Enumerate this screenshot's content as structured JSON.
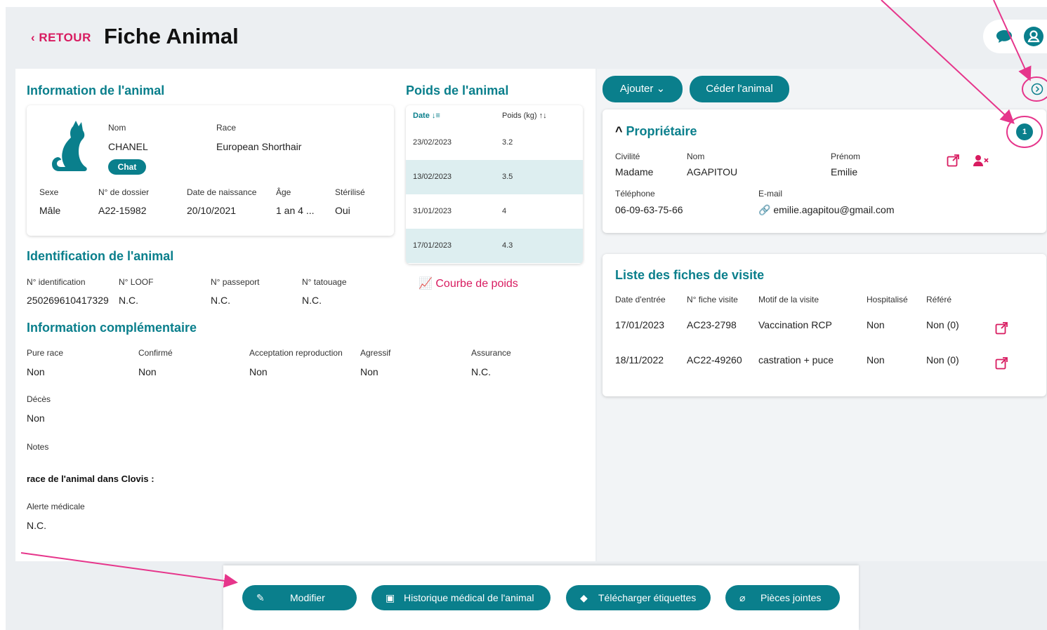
{
  "header": {
    "back_label": "‹ RETOUR",
    "title": "Fiche Animal"
  },
  "animal_info": {
    "heading": "Information de l'animal",
    "nom_label": "Nom",
    "nom": "CHANEL",
    "race_label": "Race",
    "race": "European Shorthair",
    "species_chip": "Chat",
    "sexe_label": "Sexe",
    "sexe": "Mâle",
    "dossier_label": "N° de dossier",
    "dossier": "A22-15982",
    "naissance_label": "Date de naissance",
    "naissance": "20/10/2021",
    "age_label": "Âge",
    "age": "1 an 4 ...",
    "sterilise_label": "Stérilisé",
    "sterilise": "Oui"
  },
  "weights": {
    "heading": "Poids de l'animal",
    "col_date": "Date",
    "col_poids": "Poids (kg)",
    "rows": [
      {
        "date": "23/02/2023",
        "poids": "3.2"
      },
      {
        "date": "13/02/2023",
        "poids": "3.5"
      },
      {
        "date": "31/01/2023",
        "poids": "4"
      },
      {
        "date": "17/01/2023",
        "poids": "4.3"
      }
    ],
    "curve_link": "Courbe de poids"
  },
  "identification": {
    "heading": "Identification de l'animal",
    "fields": [
      {
        "label": "N° identification",
        "value": "250269610417329"
      },
      {
        "label": "N° LOOF",
        "value": "N.C."
      },
      {
        "label": "N° passeport",
        "value": "N.C."
      },
      {
        "label": "N° tatouage",
        "value": "N.C."
      }
    ]
  },
  "complementary": {
    "heading": "Information complémentaire",
    "fields": [
      {
        "label": "Pure race",
        "value": "Non"
      },
      {
        "label": "Confirmé",
        "value": "Non"
      },
      {
        "label": "Acceptation reproduction",
        "value": "Non"
      },
      {
        "label": "Agressif",
        "value": "Non"
      },
      {
        "label": "Assurance",
        "value": "N.C."
      }
    ],
    "deces_label": "Décès",
    "deces": "Non",
    "notes_label": "Notes",
    "race_clovis_label": "race de l'animal dans Clovis :",
    "alerte_label": "Alerte médicale",
    "alerte": "N.C."
  },
  "actions": {
    "ajouter": "Ajouter",
    "ceder": "Céder l'animal"
  },
  "owner": {
    "heading": "Propriétaire",
    "badge": "1",
    "civilite_label": "Civilité",
    "civilite": "Madame",
    "nom_label": "Nom",
    "nom": "AGAPITOU",
    "prenom_label": "Prénom",
    "prenom": "Emilie",
    "tel_label": "Téléphone",
    "tel": "06-09-63-75-66",
    "email_label": "E-mail",
    "email": "emilie.agapitou@gmail.com"
  },
  "visits": {
    "heading": "Liste des fiches de visite",
    "columns": [
      "Date d'entrée",
      "N° fiche visite",
      "Motif de la visite",
      "Hospitalisé",
      "Référé"
    ],
    "rows": [
      {
        "date": "17/01/2023",
        "fiche": "AC23-2798",
        "motif": "Vaccination RCP",
        "hosp": "Non",
        "refere": "Non (0)"
      },
      {
        "date": "18/11/2022",
        "fiche": "AC22-49260",
        "motif": "castration + puce",
        "hosp": "Non",
        "refere": "Non (0)"
      }
    ]
  },
  "bottom": {
    "modifier": "Modifier",
    "historique": "Historique médical de l'animal",
    "etiquettes": "Télécharger étiquettes",
    "pieces": "Pièces jointes"
  },
  "colors": {
    "accent": "#0a7f8c",
    "pink": "#d81b60",
    "annotation": "#e6358b"
  }
}
